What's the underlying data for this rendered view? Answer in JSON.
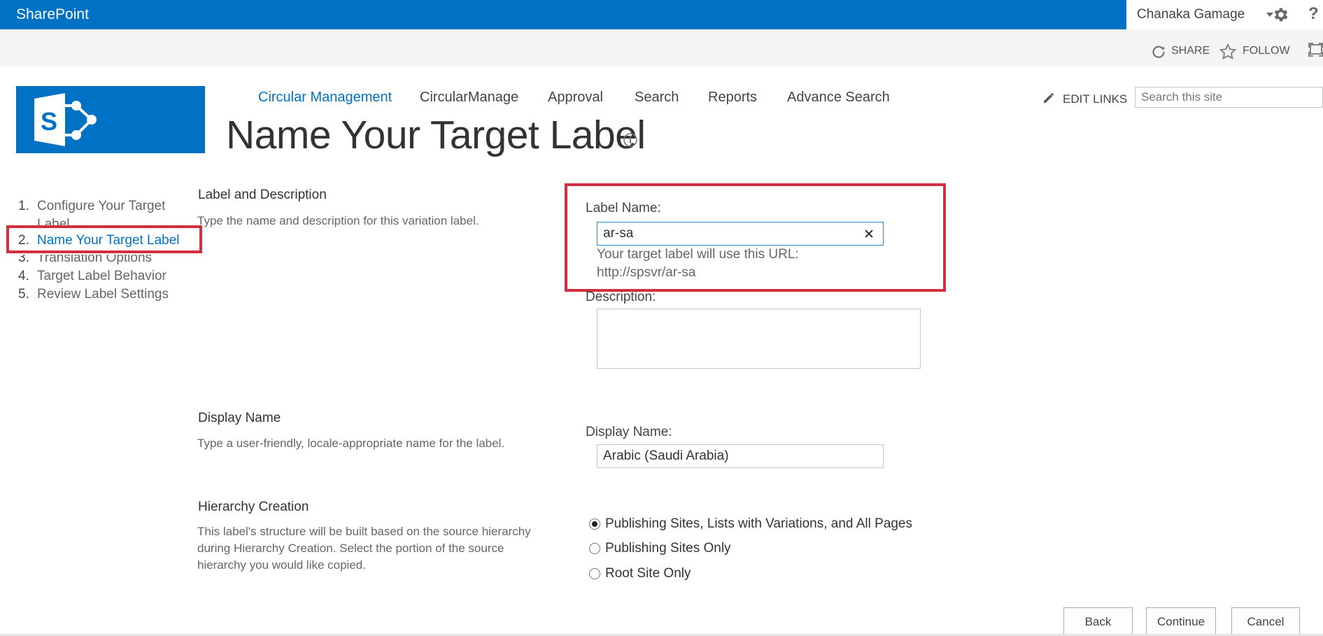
{
  "suite_bar": {
    "brand": "SharePoint",
    "user_name": "Chanaka Gamage",
    "help_glyph": "?",
    "icons": {
      "settings": "gear-icon",
      "help": "question-mark-icon"
    },
    "bar_color": "#0072c6"
  },
  "ribbon": {
    "share_label": "SHARE",
    "follow_label": "FOLLOW",
    "icons": {
      "share": "share-icon",
      "follow": "star-icon",
      "focus": "focus-on-content-icon"
    }
  },
  "top_nav": {
    "items": [
      {
        "label": "Circular Management",
        "active": true
      },
      {
        "label": "CircularManage",
        "active": false
      },
      {
        "label": "Approval",
        "active": false
      },
      {
        "label": "Search",
        "active": false
      },
      {
        "label": "Reports",
        "active": false
      },
      {
        "label": "Advance Search",
        "active": false
      }
    ],
    "edit_links_label": "EDIT LINKS",
    "search_placeholder": "Search this site"
  },
  "page": {
    "title": "Name Your Target Label",
    "accent_color": "#0072c6",
    "highlight_color": "#d32f3f"
  },
  "steps": [
    {
      "number": "1.",
      "label": "Configure Your Target Label",
      "active": false
    },
    {
      "number": "2.",
      "label": "Name Your Target Label",
      "active": true
    },
    {
      "number": "3.",
      "label": "Translation Options",
      "active": false
    },
    {
      "number": "4.",
      "label": "Target Label Behavior",
      "active": false
    },
    {
      "number": "5.",
      "label": "Review Label Settings",
      "active": false
    }
  ],
  "sections": {
    "label_description": {
      "title": "Label and Description",
      "description": "Type the name and description for this variation label.",
      "label_name_caption": "Label Name:",
      "label_name_value": "ar-sa",
      "url_caption": "Your target label will use this URL:",
      "url_value": "http://spsvr/ar-sa",
      "description_caption": "Description:",
      "description_value": ""
    },
    "display_name": {
      "title": "Display Name",
      "description": "Type a user-friendly, locale-appropriate name for the label.",
      "field_caption": "Display Name:",
      "field_value": "Arabic (Saudi Arabia)"
    },
    "hierarchy": {
      "title": "Hierarchy Creation",
      "description": "This label's structure will be built based on the source hierarchy during Hierarchy Creation.  Select the portion of the source hierarchy you would like copied.",
      "options": [
        {
          "label": "Publishing Sites, Lists with Variations, and All Pages",
          "selected": true
        },
        {
          "label": "Publishing Sites Only",
          "selected": false
        },
        {
          "label": "Root Site Only",
          "selected": false
        }
      ]
    }
  },
  "buttons": {
    "back": "Back",
    "continue": "Continue",
    "cancel": "Cancel"
  }
}
